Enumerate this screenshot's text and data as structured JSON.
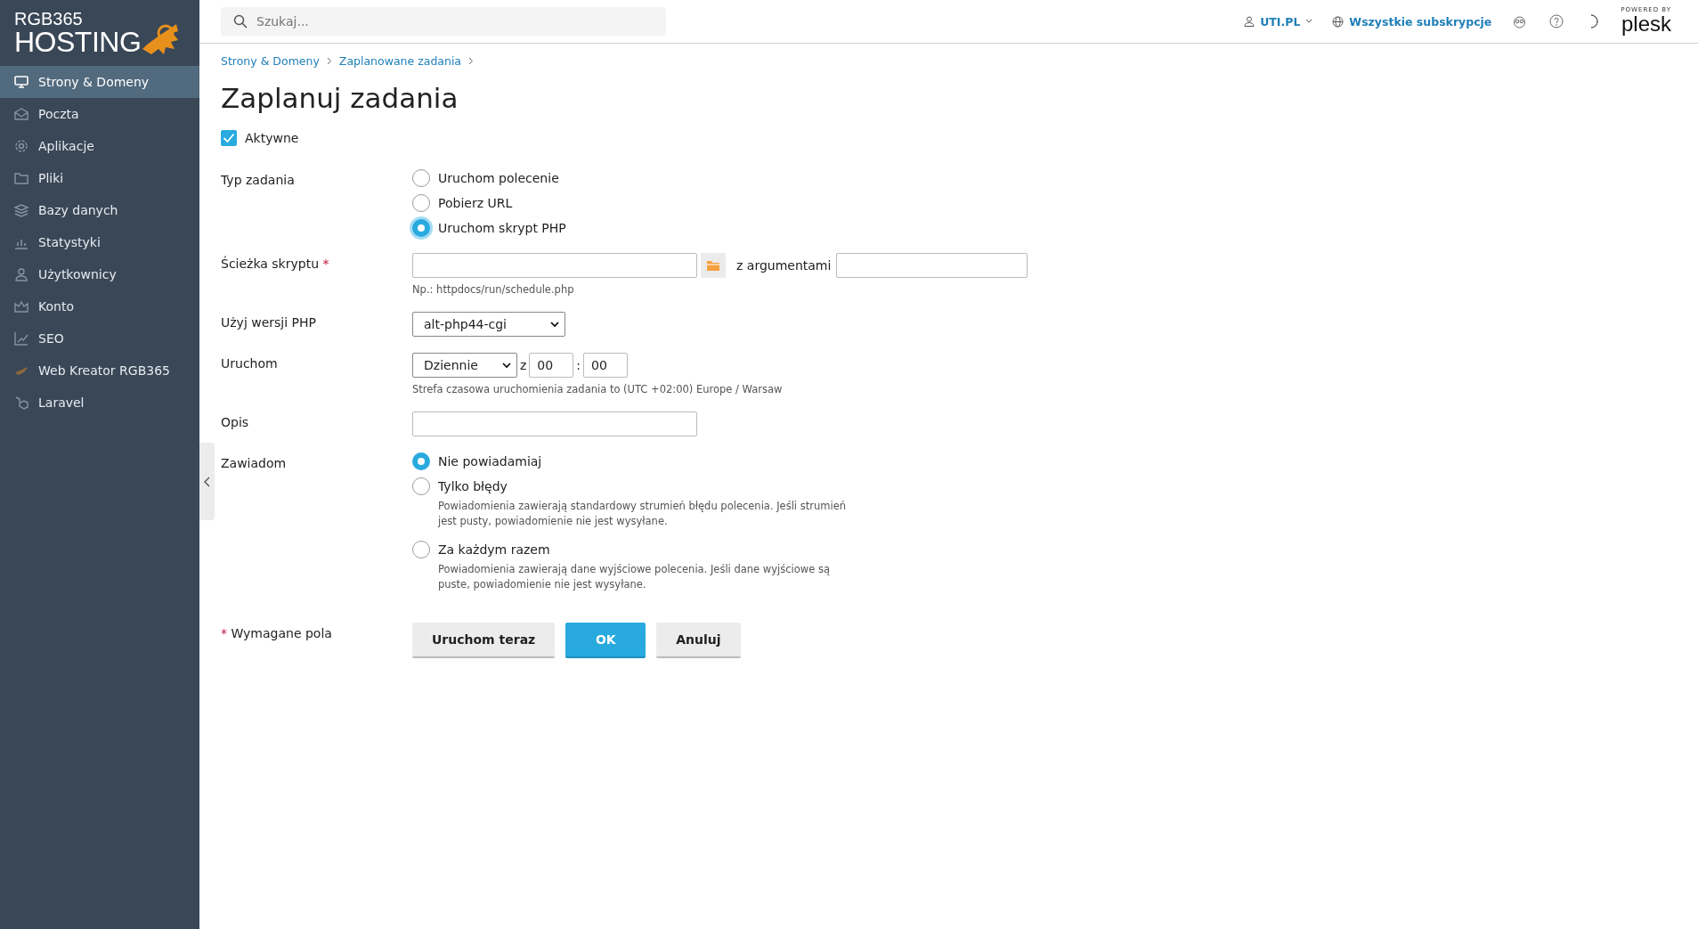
{
  "logo": {
    "line_1": "RGB365",
    "line_2": "HOSTING"
  },
  "sidebar": {
    "items": [
      {
        "label": "Strony & Domeny",
        "selected": true
      },
      {
        "label": "Poczta",
        "selected": false
      },
      {
        "label": "Aplikacje",
        "selected": false
      },
      {
        "label": "Pliki",
        "selected": false
      },
      {
        "label": "Bazy danych",
        "selected": false
      },
      {
        "label": "Statystyki",
        "selected": false
      },
      {
        "label": "Użytkownicy",
        "selected": false
      },
      {
        "label": "Konto",
        "selected": false
      },
      {
        "label": "SEO",
        "selected": false
      },
      {
        "label": "Web Kreator RGB365",
        "selected": false
      },
      {
        "label": "Laravel",
        "selected": false
      }
    ]
  },
  "topbar": {
    "search": {
      "placeholder": "Szukaj..."
    },
    "account": "UTI.PL",
    "subscriptions": "Wszystkie subskrypcje",
    "powered_by": "POWERED BY",
    "brand": "plesk"
  },
  "breadcrumbs": [
    "Strony & Domeny",
    "Zaplanowane zadania"
  ],
  "title": "Zaplanuj zadania",
  "active": {
    "label": "Aktywne",
    "checked": true
  },
  "task_type": {
    "label": "Typ zadania",
    "options": [
      {
        "label": "Uruchom polecenie",
        "selected": false
      },
      {
        "label": "Pobierz URL",
        "selected": false
      },
      {
        "label": "Uruchom skrypt PHP",
        "selected": true
      }
    ]
  },
  "script_path": {
    "label": "Ścieżka skryptu",
    "required_mark": "*",
    "args_label": "z argumentami",
    "hint": "Np.: httpdocs/run/schedule.php"
  },
  "php_version": {
    "label": "Użyj wersji PHP",
    "value": "alt-php44-cgi"
  },
  "run": {
    "label": "Uruchom",
    "frequency": "Dziennie",
    "at": "z",
    "hour": "00",
    "separator": ":",
    "minute": "00",
    "hint": "Strefa czasowa uruchomienia zadania to (UTC +02:00) Europe / Warsaw"
  },
  "description": {
    "label": "Opis"
  },
  "notify": {
    "label": "Zawiadom",
    "options": [
      {
        "label": "Nie powiadamiaj",
        "selected": true
      },
      {
        "label": "Tylko błędy",
        "selected": false,
        "hint": "Powiadomienia zawierają standardowy strumień błędu polecenia. Jeśli strumień jest pusty, powiadomienie nie jest wysyłane."
      },
      {
        "label": "Za każdym razem",
        "selected": false,
        "hint": "Powiadomienia zawierają dane wyjściowe polecenia. Jeśli dane wyjściowe są puste, powiadomienie nie jest wysyłane."
      }
    ]
  },
  "required_note": {
    "mark": "*",
    "text": "Wymagane pola"
  },
  "buttons": [
    {
      "label": "Uruchom teraz",
      "kind": "secondary"
    },
    {
      "label": "OK",
      "kind": "primary"
    },
    {
      "label": "Anuluj",
      "kind": "secondary"
    }
  ]
}
